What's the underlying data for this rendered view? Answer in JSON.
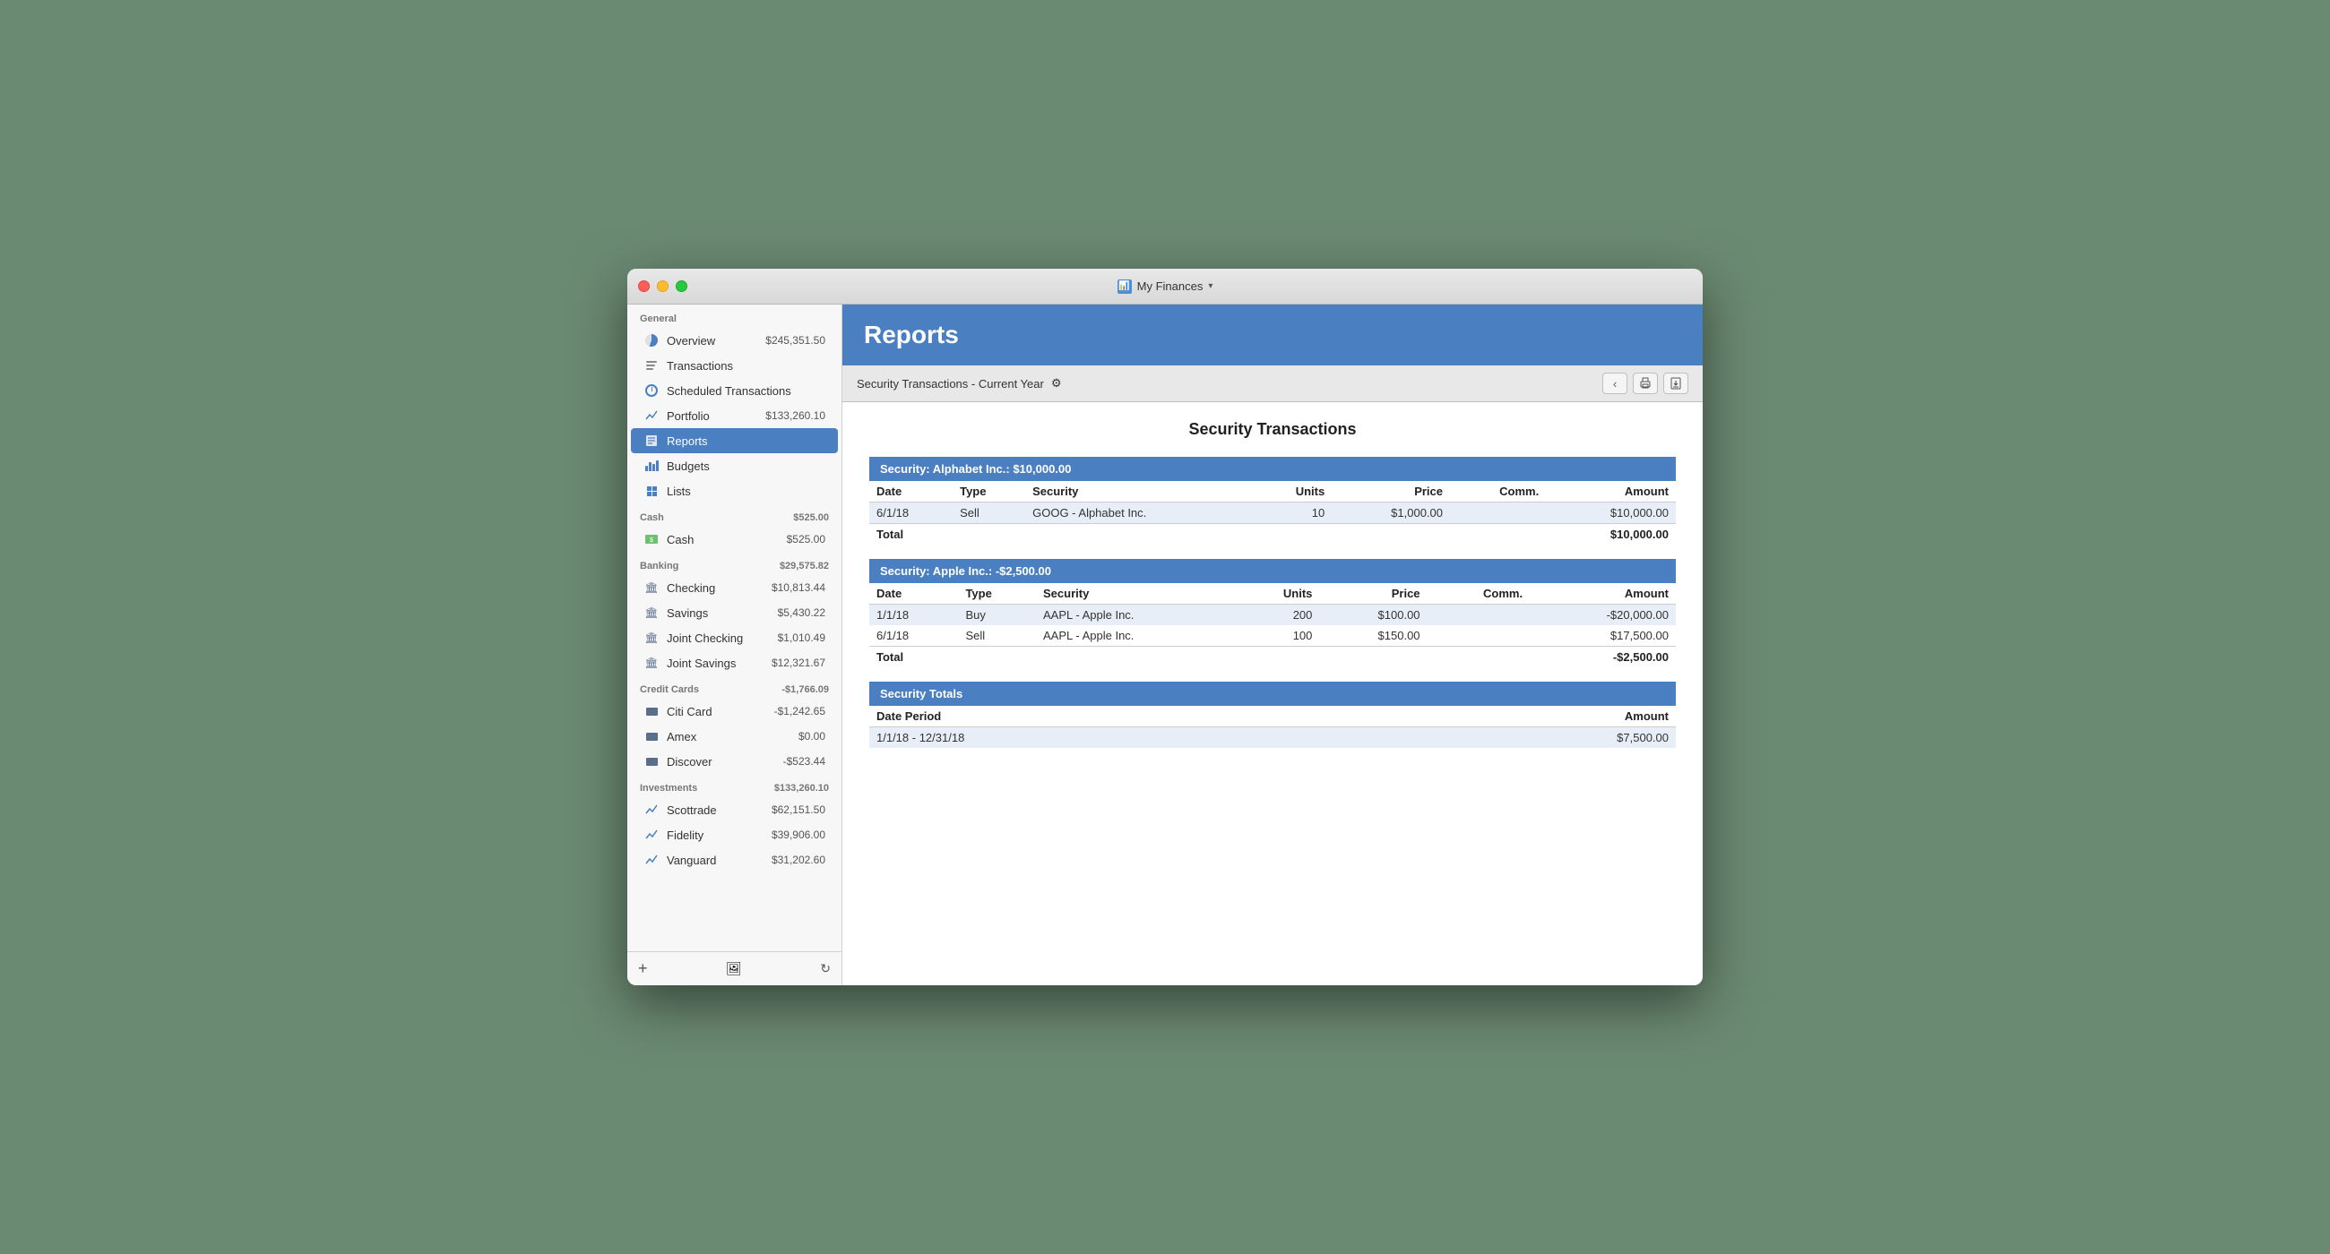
{
  "window": {
    "title": "My Finances",
    "title_icon": "📊"
  },
  "sidebar": {
    "general_label": "General",
    "items_general": [
      {
        "id": "overview",
        "label": "Overview",
        "amount": "$245,351.50",
        "icon": "pie"
      },
      {
        "id": "transactions",
        "label": "Transactions",
        "amount": "",
        "icon": "list"
      },
      {
        "id": "scheduled",
        "label": "Scheduled Transactions",
        "amount": "",
        "icon": "clock"
      },
      {
        "id": "portfolio",
        "label": "Portfolio",
        "amount": "$133,260.10",
        "icon": "chart"
      },
      {
        "id": "reports",
        "label": "Reports",
        "amount": "",
        "icon": "reports",
        "active": true
      },
      {
        "id": "budgets",
        "label": "Budgets",
        "amount": "",
        "icon": "bar"
      },
      {
        "id": "lists",
        "label": "Lists",
        "amount": "",
        "icon": "grid"
      }
    ],
    "cash_label": "Cash",
    "cash_total": "$525.00",
    "items_cash": [
      {
        "id": "cash",
        "label": "Cash",
        "amount": "$525.00",
        "icon": "cash"
      }
    ],
    "banking_label": "Banking",
    "banking_total": "$29,575.82",
    "items_banking": [
      {
        "id": "checking",
        "label": "Checking",
        "amount": "$10,813.44",
        "icon": "bank"
      },
      {
        "id": "savings",
        "label": "Savings",
        "amount": "$5,430.22",
        "icon": "bank"
      },
      {
        "id": "joint-checking",
        "label": "Joint Checking",
        "amount": "$1,010.49",
        "icon": "bank"
      },
      {
        "id": "joint-savings",
        "label": "Joint Savings",
        "amount": "$12,321.67",
        "icon": "bank"
      }
    ],
    "credit_label": "Credit Cards",
    "credit_total": "-$1,766.09",
    "items_credit": [
      {
        "id": "citi",
        "label": "Citi Card",
        "amount": "-$1,242.65",
        "icon": "cc"
      },
      {
        "id": "amex",
        "label": "Amex",
        "amount": "$0.00",
        "icon": "cc"
      },
      {
        "id": "discover",
        "label": "Discover",
        "amount": "-$523.44",
        "icon": "cc"
      }
    ],
    "investments_label": "Investments",
    "investments_total": "$133,260.10",
    "items_investments": [
      {
        "id": "scottrade",
        "label": "Scottrade",
        "amount": "$62,151.50",
        "icon": "chart"
      },
      {
        "id": "fidelity",
        "label": "Fidelity",
        "amount": "$39,906.00",
        "icon": "chart"
      },
      {
        "id": "vanguard",
        "label": "Vanguard",
        "amount": "$31,202.60",
        "icon": "chart"
      }
    ],
    "footer_add": "+",
    "footer_photo": "🖼",
    "footer_refresh": "↻"
  },
  "reports": {
    "title": "Reports",
    "toolbar": {
      "report_name": "Security Transactions - Current Year",
      "settings_icon": "⚙",
      "back_btn": "‹",
      "print_btn": "🖨",
      "export_btn": "⬆"
    },
    "main_title": "Security Transactions",
    "alphabet_section": {
      "header": "Security: Alphabet Inc.: $10,000.00",
      "columns": [
        "Date",
        "Type",
        "Security",
        "Units",
        "Price",
        "Comm.",
        "Amount"
      ],
      "rows": [
        {
          "date": "6/1/18",
          "type": "Sell",
          "security": "GOOG - Alphabet Inc.",
          "units": "10",
          "price": "$1,000.00",
          "comm": "",
          "amount": "$10,000.00"
        }
      ],
      "total_label": "Total",
      "total_amount": "$10,000.00"
    },
    "apple_section": {
      "header": "Security: Apple Inc.: -$2,500.00",
      "columns": [
        "Date",
        "Type",
        "Security",
        "Units",
        "Price",
        "Comm.",
        "Amount"
      ],
      "rows": [
        {
          "date": "1/1/18",
          "type": "Buy",
          "security": "AAPL - Apple Inc.",
          "units": "200",
          "price": "$100.00",
          "comm": "",
          "amount": "-$20,000.00"
        },
        {
          "date": "6/1/18",
          "type": "Sell",
          "security": "AAPL - Apple Inc.",
          "units": "100",
          "price": "$150.00",
          "comm": "",
          "amount": "$17,500.00"
        }
      ],
      "total_label": "Total",
      "total_amount": "-$2,500.00"
    },
    "totals_section": {
      "header": "Security Totals",
      "columns": [
        "Date Period",
        "Amount"
      ],
      "rows": [
        {
          "period": "1/1/18 - 12/31/18",
          "amount": "$7,500.00"
        }
      ]
    }
  }
}
